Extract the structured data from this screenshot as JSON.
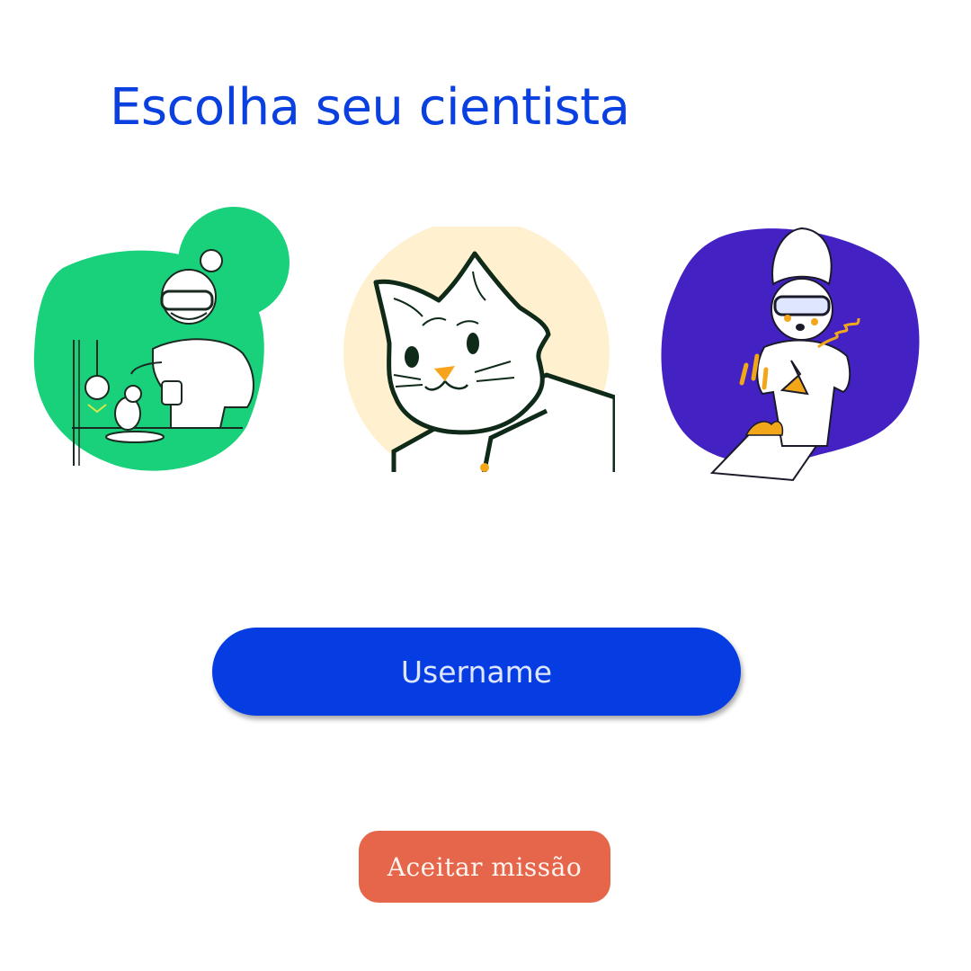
{
  "header": {
    "title": "Escolha seu cientista"
  },
  "scientists": [
    {
      "name": "scientist-woman",
      "icon": "lab-scientist-with-beaker-icon",
      "bg_color": "#1ad17b"
    },
    {
      "name": "scientist-cat",
      "icon": "cat-scientist-icon",
      "bg_color": "#fff1cf"
    },
    {
      "name": "scientist-young",
      "icon": "scientist-with-flask-icon",
      "bg_color": "#4321c2"
    }
  ],
  "form": {
    "username_placeholder": "Username",
    "username_value": "",
    "accept_label": "Aceitar missão"
  },
  "colors": {
    "title": "#0a3fe0",
    "input_bg": "#053de3",
    "button_bg": "#e5664a"
  }
}
